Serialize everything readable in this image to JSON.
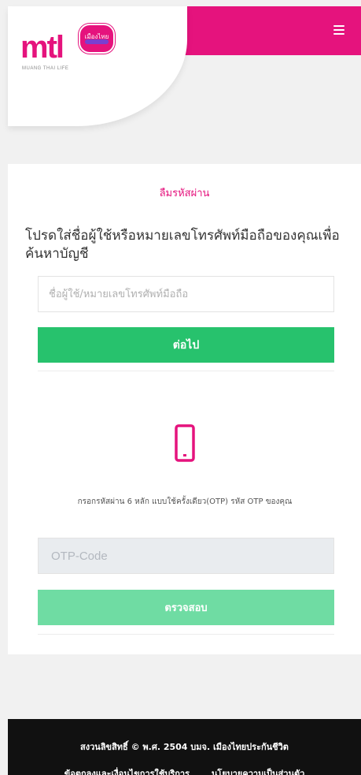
{
  "brand": {
    "logo_text": "mtl",
    "badge_text": "เมืองไทย",
    "subtitle": "MUANG THAI LIFE",
    "accent_color": "#e5137d"
  },
  "header": {
    "menu_icon": "hamburger-menu-icon"
  },
  "forgot_password": {
    "title": "ลืมรหัสผ่าน",
    "instruction": "โปรดใส่ชื่อผู้ใช้หรือหมายเลขโทรศัพท์มือถือของคุณเพื่อค้นหาบัญชี",
    "username_placeholder": "ชื่อผู้ใช้/หมายเลขโทรศัพท์มือถือ",
    "next_label": "ต่อไป"
  },
  "otp": {
    "icon": "mobile-phone-icon",
    "description": "กรอกรหัสผ่าน 6 หลัก แบบใช้ครั้งเดียว(OTP) รหัส OTP ของคุณ",
    "input_placeholder": "OTP-Code",
    "verify_label": "ตรวจสอบ"
  },
  "footer": {
    "copyright": "สงวนลิขสิทธิ์ © พ.ศ. 2504 บมจ. เมืองไทยประกันชีวิต",
    "links": [
      "ข้อตกลงและเงื่อนไขการใช้บริการ",
      "นโยบายความเป็นส่วนตัว"
    ]
  },
  "colors": {
    "primary_green": "#27c26d",
    "disabled_green": "#6fdca3",
    "footer_bg": "#111111"
  }
}
